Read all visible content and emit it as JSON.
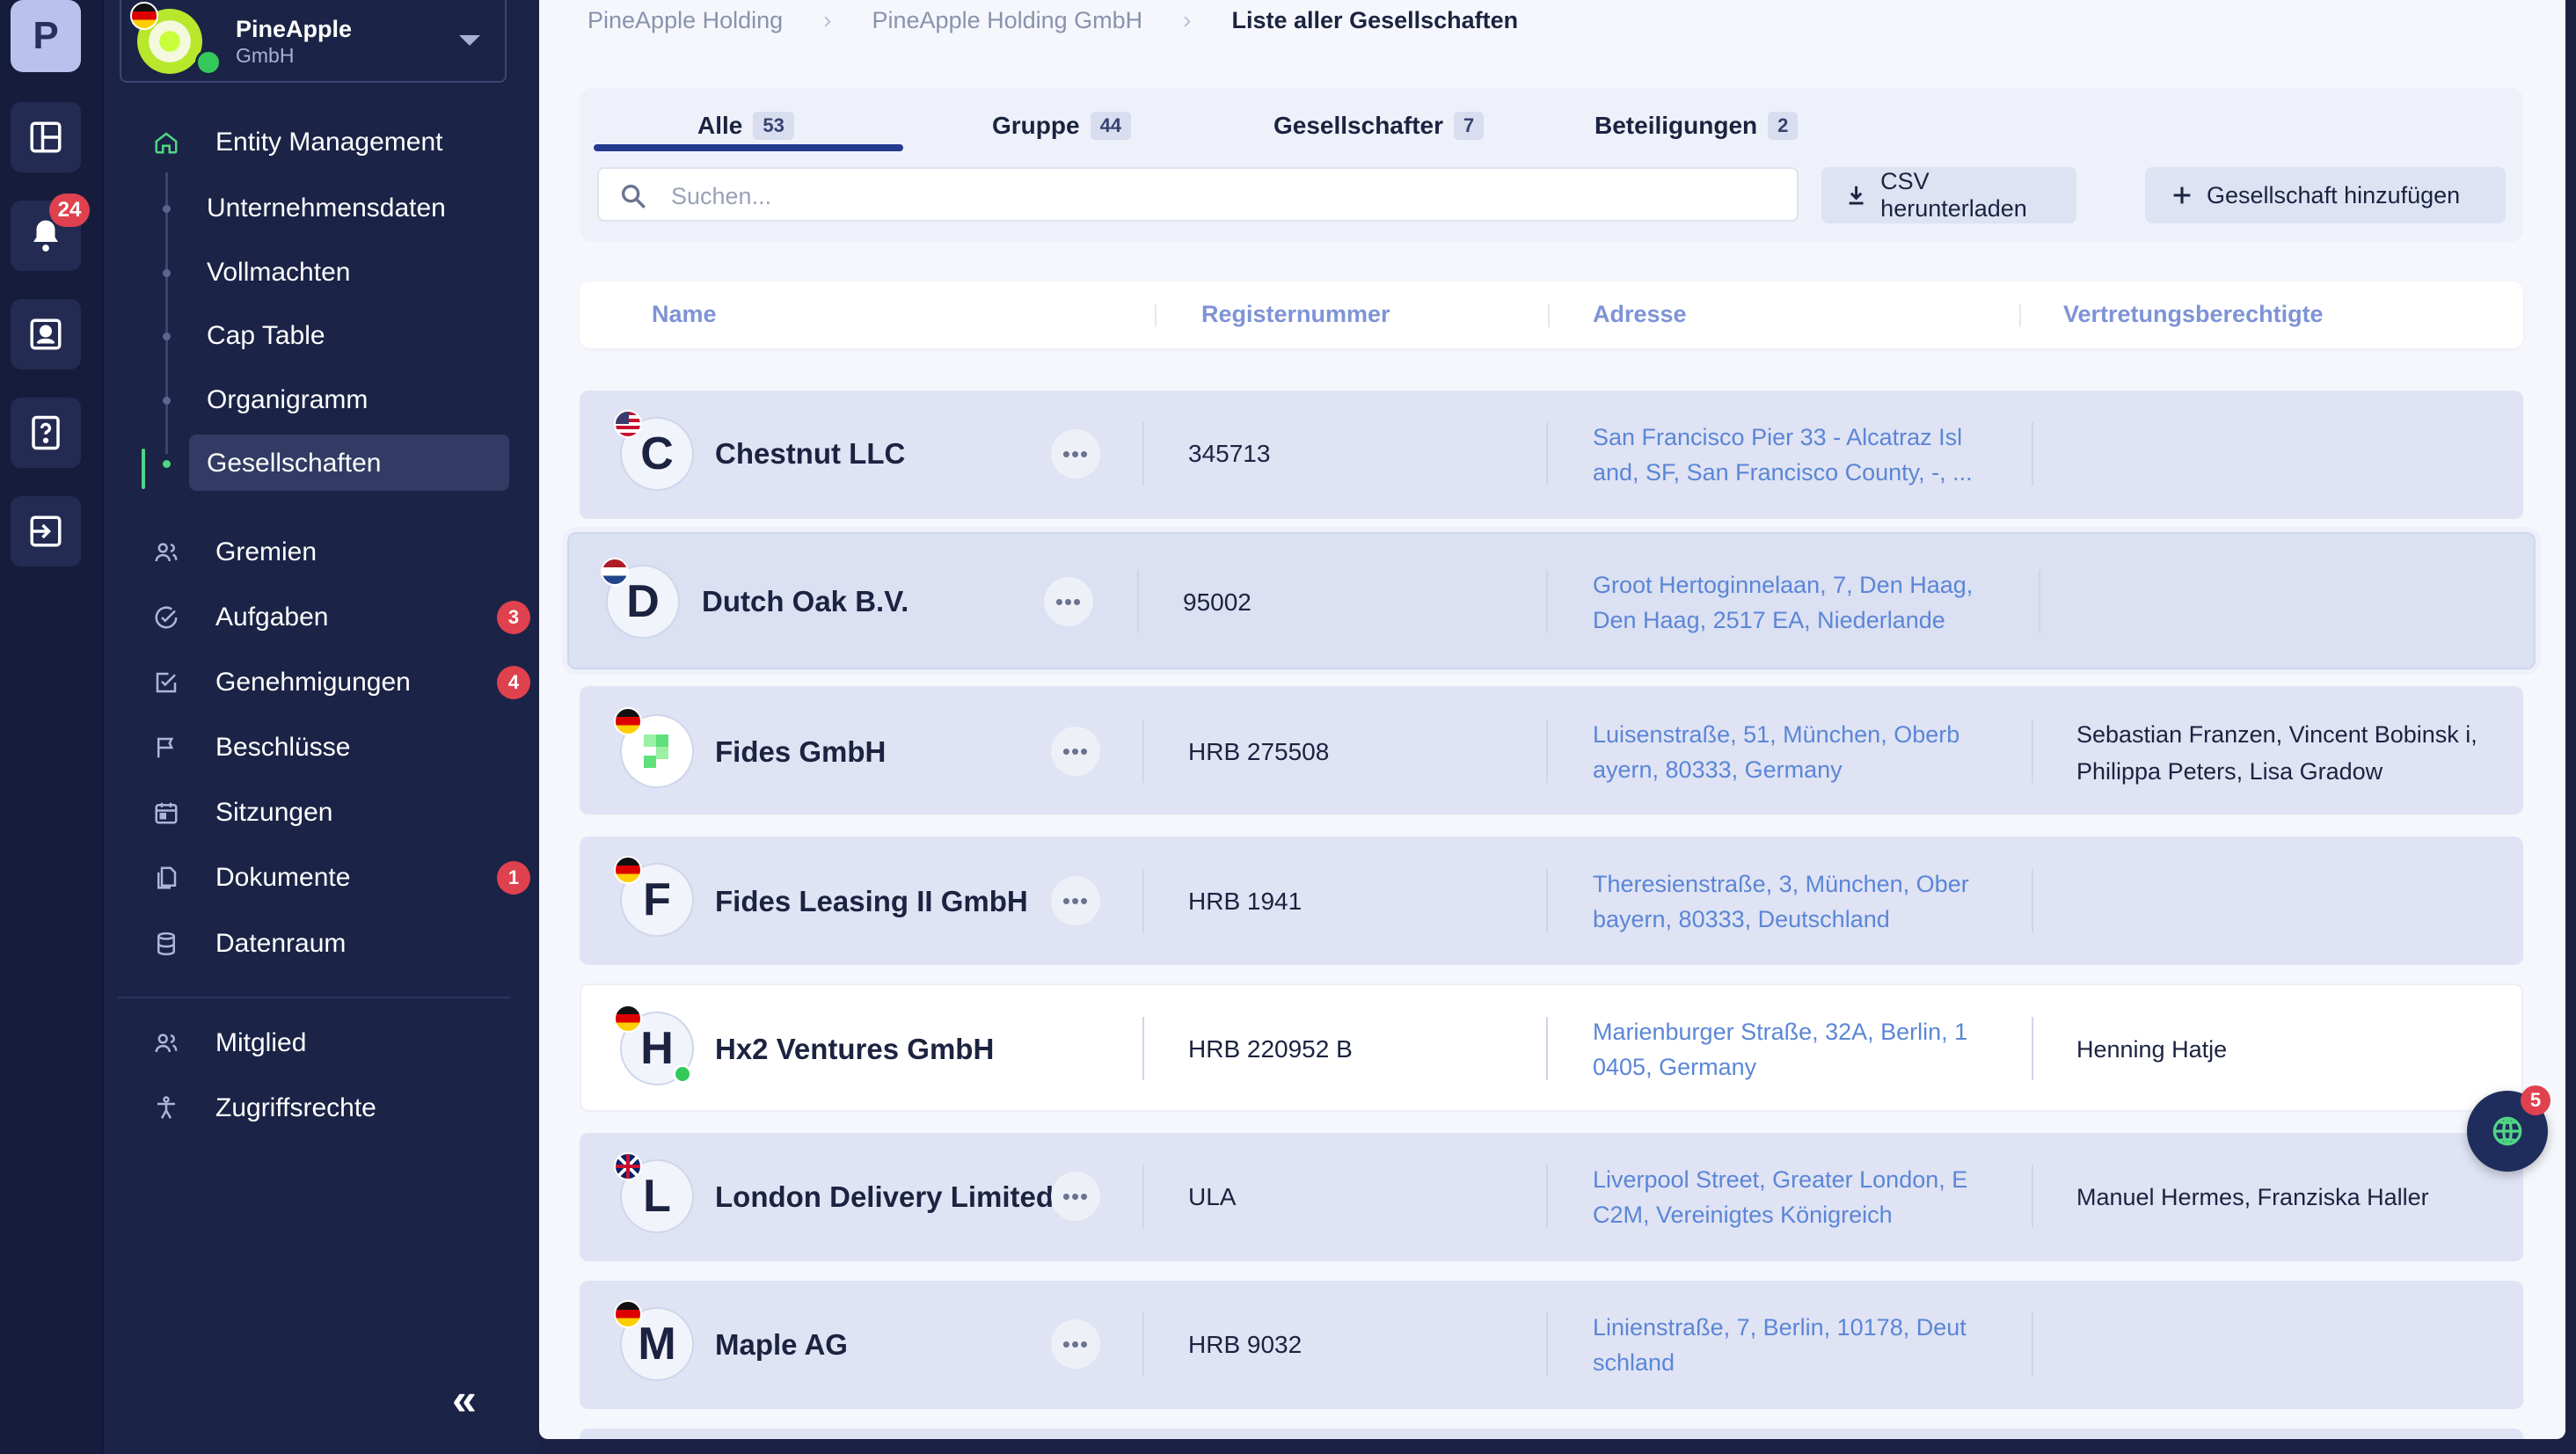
{
  "rail": {
    "logo_letter": "P",
    "notifications_count": "24"
  },
  "org": {
    "name": "PineApple",
    "type": "GmbH"
  },
  "nav": {
    "entity_management": "Entity Management",
    "sub_items": [
      "Unternehmensdaten",
      "Vollmachten",
      "Cap Table",
      "Organigramm",
      "Gesellschaften"
    ],
    "items": [
      {
        "label": "Gremien",
        "badge": ""
      },
      {
        "label": "Aufgaben",
        "badge": "3"
      },
      {
        "label": "Genehmigungen",
        "badge": "4"
      },
      {
        "label": "Beschlüsse",
        "badge": ""
      },
      {
        "label": "Sitzungen",
        "badge": ""
      },
      {
        "label": "Dokumente",
        "badge": "1"
      },
      {
        "label": "Datenraum",
        "badge": ""
      }
    ],
    "bottom_items": [
      "Mitglied",
      "Zugriffsrechte"
    ],
    "collapse_glyph": "«"
  },
  "breadcrumb": [
    "PineApple Holding",
    "PineApple Holding GmbH",
    "Liste aller Gesellschaften"
  ],
  "tabs": [
    {
      "label": "Alle",
      "count": "53"
    },
    {
      "label": "Gruppe",
      "count": "44"
    },
    {
      "label": "Gesellschafter",
      "count": "7"
    },
    {
      "label": "Beteiligungen",
      "count": "2"
    }
  ],
  "search": {
    "placeholder": "Suchen..."
  },
  "actions": {
    "csv": "CSV herunterladen",
    "add": "Gesellschaft hinzufügen"
  },
  "table": {
    "columns": [
      "Name",
      "Registernummer",
      "Adresse",
      "Vertretungsberechtigte"
    ],
    "rows": [
      {
        "initial": "C",
        "flag": "us",
        "name": "Chestnut LLC",
        "reg": "345713",
        "address": "San Francisco Pier 33 - Alcatraz Isl and, SF, San Francisco County, -, ...",
        "reps": ""
      },
      {
        "initial": "D",
        "flag": "nl",
        "name": "Dutch Oak B.V.",
        "reg": "95002",
        "address": "Groot Hertoginnelaan, 7, Den Haag, Den Haag, 2517 EA, Niederlande",
        "reps": ""
      },
      {
        "initial": "",
        "flag": "de",
        "name": "Fides GmbH",
        "reg": "HRB 275508",
        "address": "Luisenstraße, 51, München, Oberb ayern, 80333, Germany",
        "reps": "Sebastian Franzen, Vincent Bobinsk i, Philippa Peters, Lisa Gradow"
      },
      {
        "initial": "F",
        "flag": "de",
        "name": "Fides Leasing II GmbH",
        "reg": "HRB 1941",
        "address": "Theresienstraße, 3, München, Ober bayern, 80333, Deutschland",
        "reps": ""
      },
      {
        "initial": "H",
        "flag": "de",
        "name": "Hx2 Ventures GmbH",
        "reg": "HRB 220952 B",
        "address": "Marienburger Straße, 32A, Berlin, 1 0405, Germany",
        "reps": "Henning Hatje"
      },
      {
        "initial": "L",
        "flag": "gb",
        "name": "London Delivery Limited",
        "reg": "ULA",
        "address": "Liverpool Street, Greater London, E C2M, Vereinigtes Königreich",
        "reps": "Manuel Hermes, Franziska Haller"
      },
      {
        "initial": "M",
        "flag": "de",
        "name": "Maple AG",
        "reg": "HRB 9032",
        "address": "Linienstraße, 7, Berlin, 10178, Deut schland",
        "reps": ""
      }
    ]
  },
  "fab": {
    "badge": "5"
  },
  "colors": {
    "accent": "#243a8e",
    "badge": "#e0414e",
    "link": "#5b86d6",
    "online": "#34c85a"
  }
}
